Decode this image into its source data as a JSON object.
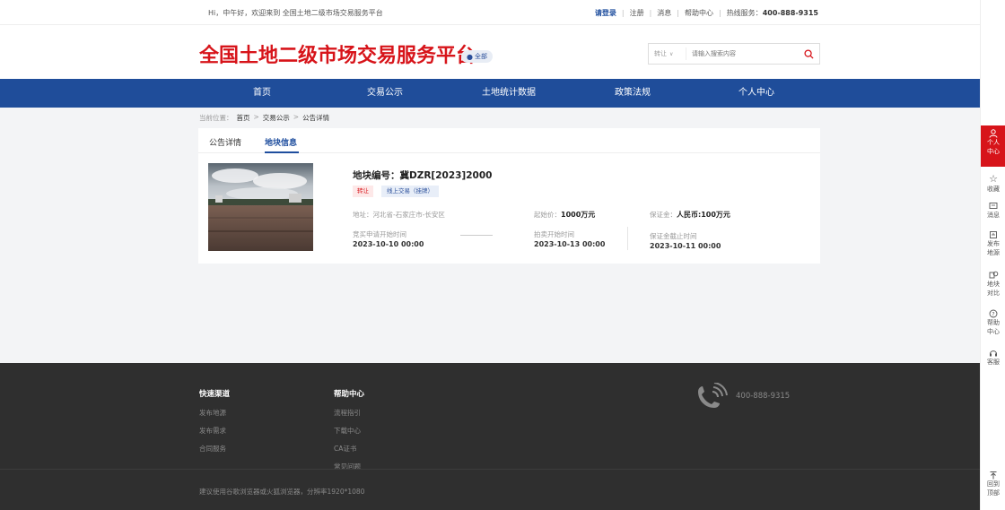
{
  "topbar": {
    "greeting": "Hi，中午好，欢迎来到 全国土地二级市场交易服务平台",
    "login": "请登录",
    "register": "注册",
    "messages": "消息",
    "help": "帮助中心",
    "hotline_label": "热线服务：",
    "hotline": "400-888-9315"
  },
  "header": {
    "logo": "全国土地二级市场交易服务平台",
    "region": "全部",
    "search_type": "转让",
    "search_placeholder": "请输入搜索内容"
  },
  "nav": [
    "首页",
    "交易公示",
    "土地统计数据",
    "政策法规",
    "个人中心"
  ],
  "breadcrumb": {
    "prefix": "当前位置：",
    "items": [
      "首页",
      "交易公示",
      "公告详情"
    ]
  },
  "detail": {
    "tabs": [
      "公告详情",
      "地块信息"
    ],
    "active_tab": 1,
    "title": "地块编号：冀DZR[2023]2000",
    "tag_type": "转让",
    "tag_mode": "线上交易（挂牌）",
    "address_label": "地址：",
    "address": "河北省-石家庄市-长安区",
    "start_price_label": "起始价：",
    "start_price": "1000万元",
    "deposit_label": "保证金：",
    "deposit": "人民币:100万元",
    "apply_start_label": "竞买申请开始时间",
    "apply_start": "2023-10-10 00:00",
    "auction_start_label": "拍卖开始时间",
    "auction_start": "2023-10-13 00:00",
    "deposit_deadline_label": "保证金截止时间",
    "deposit_deadline": "2023-10-11 00:00"
  },
  "footer": {
    "quick_title": "快速渠道",
    "quick_links": [
      "发布地源",
      "发布需求",
      "合同服务"
    ],
    "help_title": "帮助中心",
    "help_links": [
      "流程指引",
      "下载中心",
      "CA证书",
      "常见问题"
    ],
    "phone": "400-888-9315",
    "copyright": "建议使用谷歌浏览器或火狐浏览器，分辨率1920*1080"
  },
  "rail": {
    "items": [
      {
        "label": "个人中心",
        "icon": "user-icon"
      },
      {
        "label": "收藏",
        "icon": "star-icon"
      },
      {
        "label": "消息",
        "icon": "message-icon"
      },
      {
        "label": "发布地源",
        "icon": "publish-icon"
      },
      {
        "label": "地块对比",
        "icon": "compare-icon"
      },
      {
        "label": "帮助中心",
        "icon": "help-icon"
      },
      {
        "label": "客服",
        "icon": "headset-icon"
      }
    ],
    "back_top": "回到顶部"
  },
  "colors": {
    "brand_red": "#d7141a",
    "nav_blue": "#1f4d9a",
    "footer_bg": "#2f2f2f"
  }
}
